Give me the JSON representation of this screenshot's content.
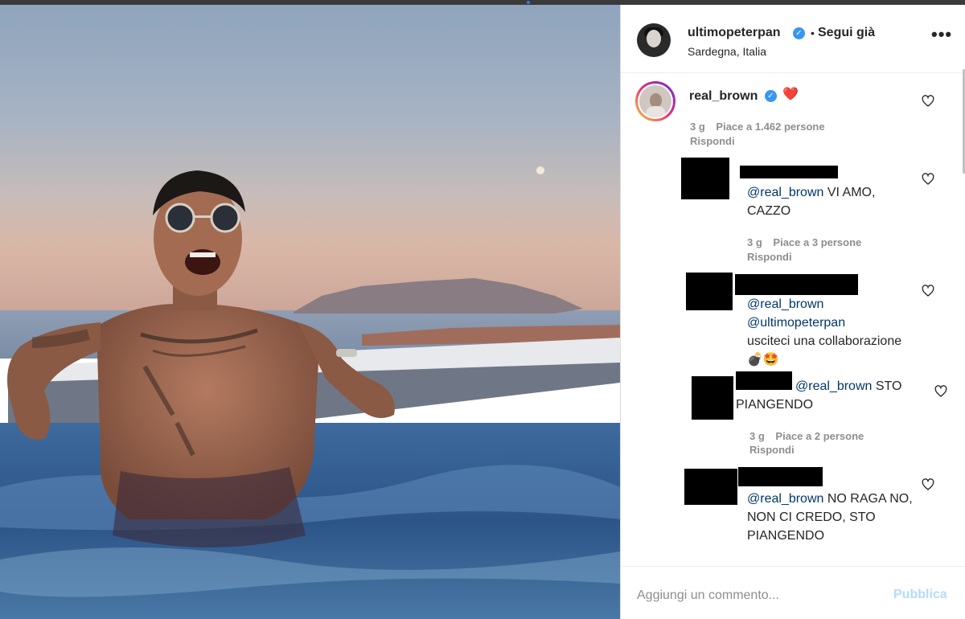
{
  "post": {
    "author": "ultimopeterpan",
    "follow_status": "Segui già",
    "separator": "•",
    "location": "Sardegna, Italia",
    "more_glyph": "•••",
    "verified_glyph": "✓"
  },
  "comments": {
    "main": {
      "username": "real_brown",
      "text": "❤️",
      "age": "3 g",
      "likes": "Piace a 1.462 persone",
      "reply": "Rispondi"
    },
    "replies": [
      {
        "mention": "@real_brown",
        "text": " VI AMO, CAZZO",
        "age": "3 g",
        "likes": "Piace a 3 persone",
        "reply": "Rispondi"
      },
      {
        "mention": "@real_brown",
        "mention2": "@ultimopeterpan",
        "text": "usciteci una collaborazione 💣🤩"
      },
      {
        "mention": "@real_brown",
        "text": " STO PIANGENDO",
        "age": "3 g",
        "likes": "Piace a 2 persone",
        "reply": "Rispondi"
      },
      {
        "mention": "@real_brown",
        "text": " NO RAGA NO, NON CI CREDO, STO PIANGENDO"
      }
    ]
  },
  "footer": {
    "placeholder": "Aggiungi un commento...",
    "publish": "Pubblica"
  },
  "icons": {
    "heart": "heart-icon",
    "more": "more-options-icon",
    "verified": "verified-badge-icon"
  },
  "colors": {
    "verified": "#3897f0",
    "mention": "#00376b",
    "publish_disabled": "#b3dbff",
    "meta": "#8e8e8e"
  }
}
